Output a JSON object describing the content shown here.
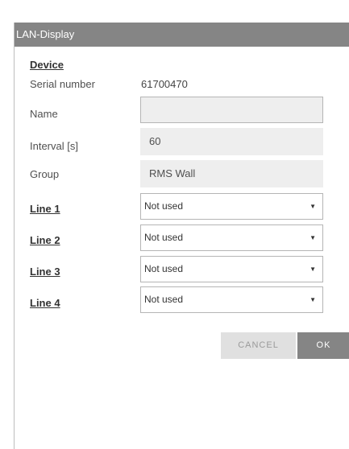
{
  "dialog": {
    "title": "LAN-Display"
  },
  "device": {
    "section_title": "Device",
    "serial_label": "Serial number",
    "serial_value": "61700470",
    "name_label": "Name",
    "name_value": "",
    "interval_label": "Interval [s]",
    "interval_value": "60",
    "group_label": "Group",
    "group_value": "RMS Wall"
  },
  "lines": [
    {
      "label": "Line 1",
      "value": "Not used"
    },
    {
      "label": "Line 2",
      "value": "Not used"
    },
    {
      "label": "Line 3",
      "value": "Not used"
    },
    {
      "label": "Line 4",
      "value": "Not used"
    }
  ],
  "buttons": {
    "cancel_label": "CANCEL",
    "ok_label": "OK"
  },
  "icons": {
    "dropdown": "chevron-down-icon"
  },
  "colors": {
    "titlebar": "#858585",
    "field_bg": "#eeeeee",
    "ok_button": "#858585",
    "cancel_button": "#e0e0e0"
  }
}
